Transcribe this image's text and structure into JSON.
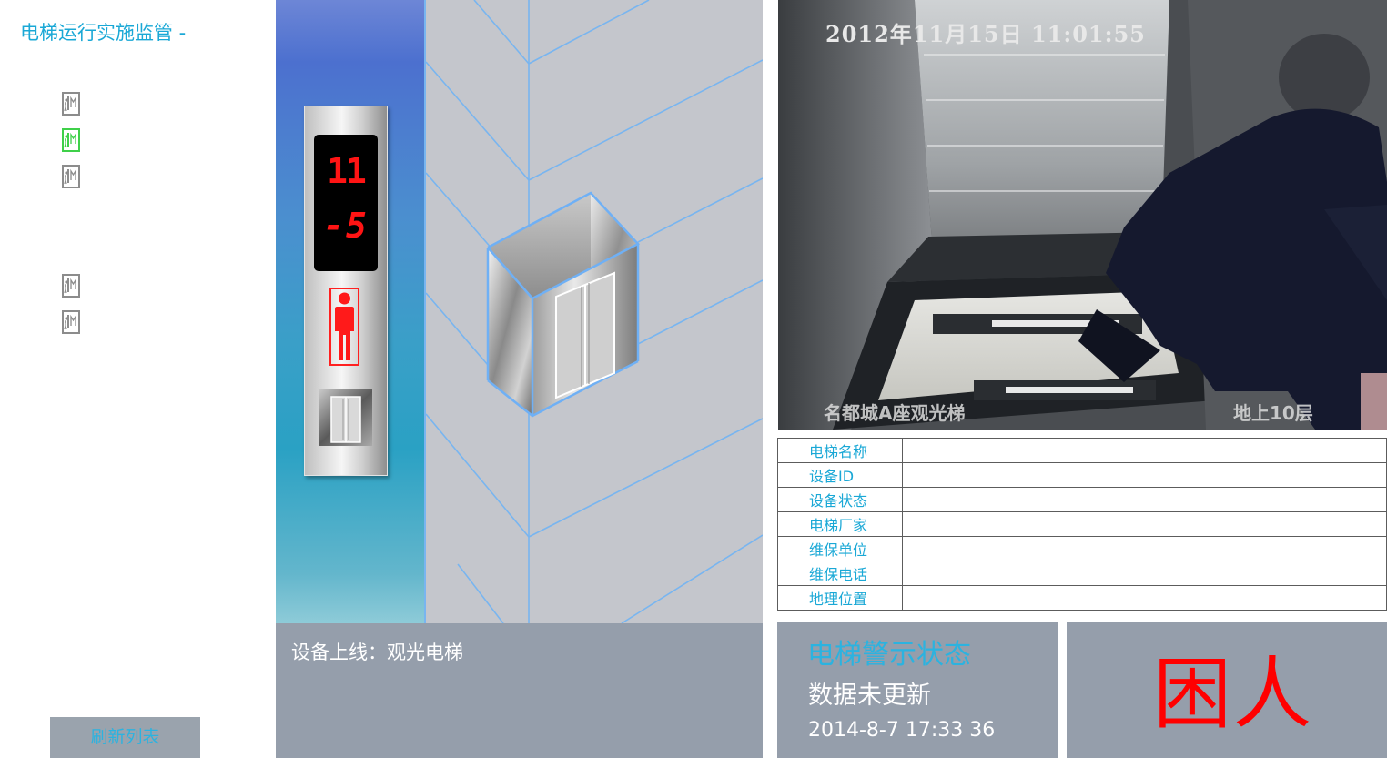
{
  "sidebar": {
    "title": "电梯运行实施监管 -",
    "elevators": [
      {
        "name": "elevator-1",
        "active": false
      },
      {
        "name": "elevator-2",
        "active": true
      },
      {
        "name": "elevator-3",
        "active": false
      },
      {
        "name": "elevator-4",
        "active": false
      },
      {
        "name": "elevator-5",
        "active": false
      }
    ],
    "refresh_label": "刷新列表"
  },
  "elevator_panel": {
    "floor": "11",
    "direction_code": "-5",
    "passenger_icon": "person-icon",
    "door_icon": "elevator-door-icon",
    "colors": {
      "display_red": "#ff1414",
      "shaft_line": "#78b5f0"
    }
  },
  "status_bar": {
    "online_text": "设备上线：观光电梯"
  },
  "camera": {
    "timestamp": "2012年11月15日 11:01:55",
    "location_label": "名都城A座观光梯",
    "floor_label": "地上10层"
  },
  "info_table": [
    {
      "label": "电梯名称",
      "value": ""
    },
    {
      "label": "设备ID",
      "value": ""
    },
    {
      "label": "设备状态",
      "value": ""
    },
    {
      "label": "电梯厂家",
      "value": ""
    },
    {
      "label": "维保单位",
      "value": ""
    },
    {
      "label": "维保电话",
      "value": ""
    },
    {
      "label": "地理位置",
      "value": ""
    }
  ],
  "warning": {
    "title": "电梯警示状态",
    "data_status": "数据未更新",
    "update_time": "2014-8-7 17:33 36"
  },
  "alarm": {
    "text": "困人",
    "color": "#ff0000"
  }
}
